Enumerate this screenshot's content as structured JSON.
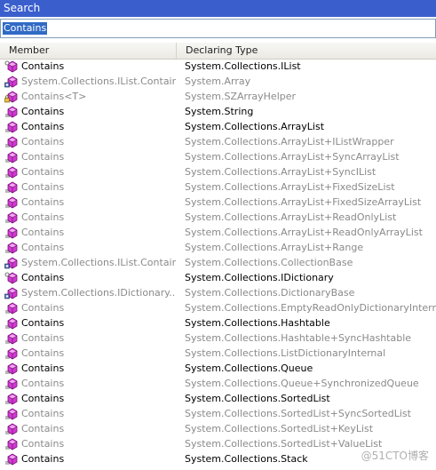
{
  "window": {
    "title": "Search"
  },
  "search": {
    "value": "Contains"
  },
  "columns": {
    "member": "Member",
    "declaring_type": "Declaring Type"
  },
  "rows": [
    {
      "member": "Contains",
      "type": "System.Collections.IList",
      "dim": false,
      "icon": "interface-method-icon"
    },
    {
      "member": "System.Collections.IList.Contains",
      "type": "System.Array",
      "dim": true,
      "icon": "explicit-method-icon"
    },
    {
      "member": "Contains<T>",
      "type": "System.SZArrayHelper",
      "dim": true,
      "icon": "private-method-icon"
    },
    {
      "member": "Contains",
      "type": "System.String",
      "dim": false,
      "icon": "method-icon"
    },
    {
      "member": "Contains",
      "type": "System.Collections.ArrayList",
      "dim": false,
      "icon": "method-icon"
    },
    {
      "member": "Contains",
      "type": "System.Collections.ArrayList+IListWrapper",
      "dim": true,
      "icon": "method-icon"
    },
    {
      "member": "Contains",
      "type": "System.Collections.ArrayList+SyncArrayList",
      "dim": true,
      "icon": "method-icon"
    },
    {
      "member": "Contains",
      "type": "System.Collections.ArrayList+SyncIList",
      "dim": true,
      "icon": "method-icon"
    },
    {
      "member": "Contains",
      "type": "System.Collections.ArrayList+FixedSizeList",
      "dim": true,
      "icon": "method-icon"
    },
    {
      "member": "Contains",
      "type": "System.Collections.ArrayList+FixedSizeArrayList",
      "dim": true,
      "icon": "method-icon"
    },
    {
      "member": "Contains",
      "type": "System.Collections.ArrayList+ReadOnlyList",
      "dim": true,
      "icon": "method-icon"
    },
    {
      "member": "Contains",
      "type": "System.Collections.ArrayList+ReadOnlyArrayList",
      "dim": true,
      "icon": "method-icon"
    },
    {
      "member": "Contains",
      "type": "System.Collections.ArrayList+Range",
      "dim": true,
      "icon": "method-icon"
    },
    {
      "member": "System.Collections.IList.Contains",
      "type": "System.Collections.CollectionBase",
      "dim": true,
      "icon": "explicit-method-icon"
    },
    {
      "member": "Contains",
      "type": "System.Collections.IDictionary",
      "dim": false,
      "icon": "interface-method-icon"
    },
    {
      "member": "System.Collections.IDictionary....",
      "type": "System.Collections.DictionaryBase",
      "dim": true,
      "icon": "explicit-method-icon"
    },
    {
      "member": "Contains",
      "type": "System.Collections.EmptyReadOnlyDictionaryInternal",
      "dim": true,
      "icon": "method-icon"
    },
    {
      "member": "Contains",
      "type": "System.Collections.Hashtable",
      "dim": false,
      "icon": "method-icon"
    },
    {
      "member": "Contains",
      "type": "System.Collections.Hashtable+SyncHashtable",
      "dim": true,
      "icon": "method-icon"
    },
    {
      "member": "Contains",
      "type": "System.Collections.ListDictionaryInternal",
      "dim": true,
      "icon": "method-icon"
    },
    {
      "member": "Contains",
      "type": "System.Collections.Queue",
      "dim": false,
      "icon": "method-icon"
    },
    {
      "member": "Contains",
      "type": "System.Collections.Queue+SynchronizedQueue",
      "dim": true,
      "icon": "method-icon"
    },
    {
      "member": "Contains",
      "type": "System.Collections.SortedList",
      "dim": false,
      "icon": "method-icon"
    },
    {
      "member": "Contains",
      "type": "System.Collections.SortedList+SyncSortedList",
      "dim": true,
      "icon": "method-icon"
    },
    {
      "member": "Contains",
      "type": "System.Collections.SortedList+KeyList",
      "dim": true,
      "icon": "method-icon"
    },
    {
      "member": "Contains",
      "type": "System.Collections.SortedList+ValueList",
      "dim": true,
      "icon": "method-icon"
    },
    {
      "member": "Contains",
      "type": "System.Collections.Stack",
      "dim": false,
      "icon": "method-icon"
    }
  ],
  "watermark": "@51CTO博客",
  "colors": {
    "titlebar": "#3a5fcd",
    "selection": "#316ac5",
    "dim_text": "#8a8a8a",
    "method_icon": "#c020c0"
  }
}
